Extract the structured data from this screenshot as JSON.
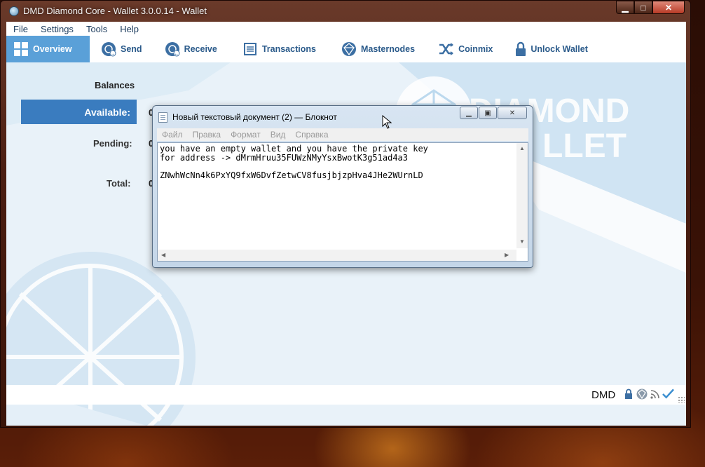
{
  "window": {
    "title": "DMD Diamond Core - Wallet 3.0.0.14 - Wallet",
    "controls": [
      "minimize-icon",
      "maximize-icon",
      "close-icon"
    ]
  },
  "menu": [
    "File",
    "Settings",
    "Tools",
    "Help"
  ],
  "toolbar": {
    "tabs": [
      {
        "label": "Overview",
        "icon": "overview-icon",
        "active": true
      },
      {
        "label": "Send",
        "icon": "send-icon"
      },
      {
        "label": "Receive",
        "icon": "receive-icon"
      },
      {
        "label": "Transactions",
        "icon": "transactions-icon"
      },
      {
        "label": "Masternodes",
        "icon": "masternodes-icon"
      },
      {
        "label": "Coinmix",
        "icon": "coinmix-icon"
      },
      {
        "label": "Unlock Wallet",
        "icon": "lock-icon"
      }
    ]
  },
  "balances": {
    "title": "Balances",
    "available_label": "Available:",
    "available_value": "0",
    "pending_label": "Pending:",
    "pending_value": "0",
    "total_label": "Total:",
    "total_value": "0"
  },
  "background_logo": {
    "line1": "DIAMOND",
    "line2": "LLET"
  },
  "statusbar": {
    "unit": "DMD",
    "icons": [
      "lock-icon",
      "diamond-icon",
      "network-icon",
      "sync-check-icon"
    ]
  },
  "notepad": {
    "title": "Новый текстовый документ (2) — Блокнот",
    "menu": [
      "Файл",
      "Правка",
      "Формат",
      "Вид",
      "Справка"
    ],
    "content": "you have an empty wallet and you have the private key\nfor address -> dMrmHruu35FUWzNMyYsxBwotK3g51ad4a3\n\nZNwhWcNn4k6PxYQ9fxW6DvfZetwCV8fusjbjzpHva4JHe2WUrnLD"
  },
  "colors": {
    "accent": "#3a7cbf",
    "active_tab": "#5aa0d8",
    "tab_text": "#2a5a8a",
    "content_bg": "#e9f2f9"
  }
}
